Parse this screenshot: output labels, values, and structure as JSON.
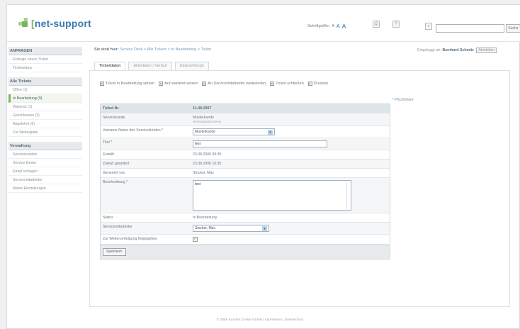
{
  "header": {
    "logo": {
      "bracket_left": "[",
      "text": "net-support",
      "bracket_right": ""
    },
    "font_size_label": "Schriftgröße:",
    "font_size_options": [
      "A",
      "A",
      "A"
    ],
    "search": {
      "value": "",
      "placeholder": ""
    },
    "search_button": "Suche"
  },
  "sidebar": {
    "groups": [
      {
        "title": "ANFRAGEN",
        "items": [
          "Erzeuge neues Ticket",
          "Ticketstatus"
        ]
      },
      {
        "title": "Alle Tickets",
        "items": [
          "Offen (1)",
          "In Bearbeitung (9)",
          "Wartend (1)",
          "Geschlossen (3)",
          "Abgelehnt (0)",
          "Zur Weitergabe"
        ]
      },
      {
        "title": "Verwaltung",
        "items": [
          "Servicekunden",
          "Service Desks",
          "Email Vorlagen",
          "Servicemitarbeiter",
          "Meine Einstellungen"
        ]
      }
    ],
    "active_item": "In Bearbeitung (9)"
  },
  "breadcrumb": {
    "prefix": "Sie sind hier:",
    "path": "Service Desk > Alle Tickets > In Bearbeitung >",
    "current": "Ticket"
  },
  "user": {
    "label": "Eingeloggt als:",
    "name": "Bernhard Schmitz",
    "logout": "Abmelden"
  },
  "tabs": [
    "Ticketdaten",
    "Aktivitäten / Verlauf",
    "Dateianhänge"
  ],
  "active_tab": "Ticketdaten",
  "actions": [
    "Ticket in Bearbeitung setzen",
    "Auf wartend setzen",
    "An Servicemitarbeiter weiterleiten",
    "Ticket schließen",
    "Drucken"
  ],
  "required_note": "* Pflichtfelder",
  "form": {
    "header": {
      "label": "Ticket-Nr.",
      "value": "11-08-2007"
    },
    "service_customer": {
      "label": "Servicekunde",
      "value_line1": "Musterkunde",
      "value_line2": "Serviceportal Demo"
    },
    "first_name_last_name": {
      "label": "Vorname Name des Servicekunden *",
      "value": "Musterkunde"
    },
    "title": {
      "label": "Titel *",
      "value": "test"
    },
    "created": {
      "label": "Erstellt",
      "value": "23.08.2006 09:35"
    },
    "last_changed": {
      "label": "Zuletzt geändert",
      "value": "23.08.2006 10:35"
    },
    "creator": {
      "label": "Generiert von",
      "value": "Stocker, Max"
    },
    "description": {
      "label": "Beschreibung *",
      "value": "test"
    },
    "status": {
      "label": "Status",
      "value": "In Bearbeitung"
    },
    "service_employee": {
      "label": "Servicemitarbeiter",
      "value": "Stocker, Max"
    },
    "unlock": {
      "label": "Zur Weiterverfolgung freigegeben",
      "checked": true
    },
    "save_label": "Speichern"
  },
  "footer": "© 2006 Kunden Center GmbH | Impressum | Datenschutz"
}
